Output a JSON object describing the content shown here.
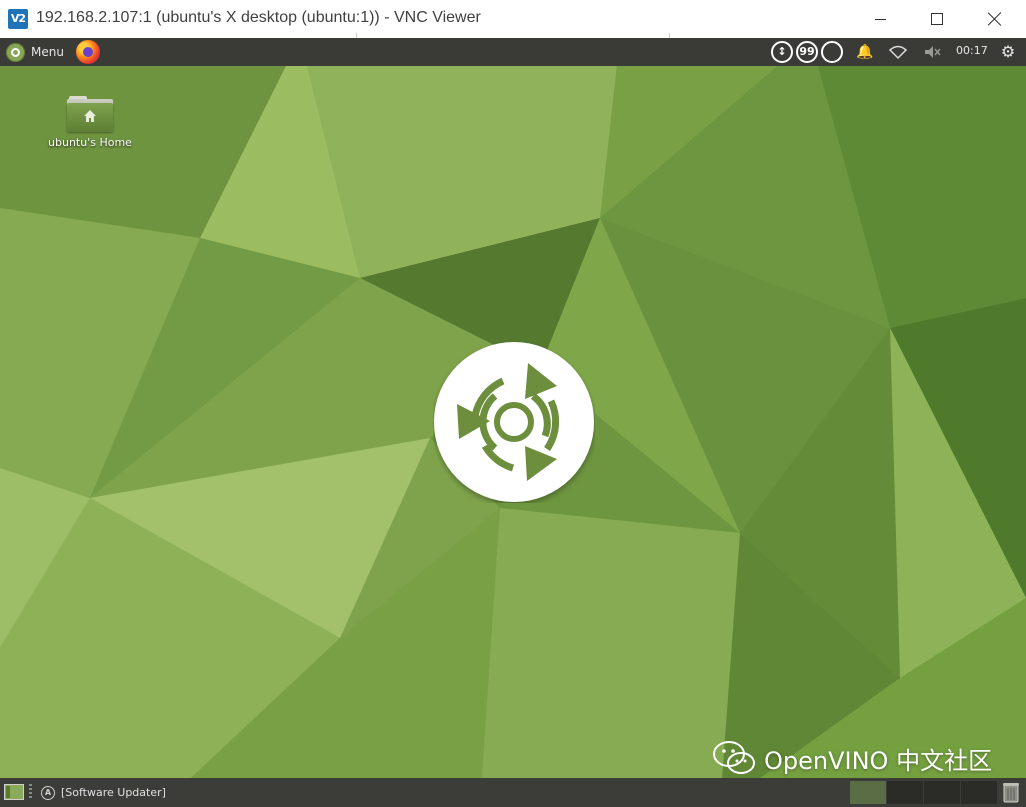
{
  "window": {
    "logo_text": "V2",
    "title": "192.168.2.107:1 (ubuntu's X desktop (ubuntu:1)) - VNC Viewer"
  },
  "top_panel": {
    "menu_label": "Menu",
    "tray_icon_1": "↕",
    "tray_icon_2": "99",
    "tray_icon_3": "bell",
    "bell_glyph": "🔔",
    "wifi_glyph": "◇",
    "volume_glyph": "🔇",
    "clock": "00:17",
    "settings_glyph": "⚙"
  },
  "desktop_icons": [
    {
      "label": "ubuntu's Home",
      "icon": "home-folder-icon"
    }
  ],
  "bottom_panel": {
    "task_label": "[Software Updater]",
    "task_icon_glyph": "A"
  },
  "watermark": {
    "text": "OpenVINO 中文社区"
  },
  "colors": {
    "panel": "#3a3a36",
    "wallpaper_green": "#7ea34a",
    "accent_blue": "#1f73b7"
  }
}
